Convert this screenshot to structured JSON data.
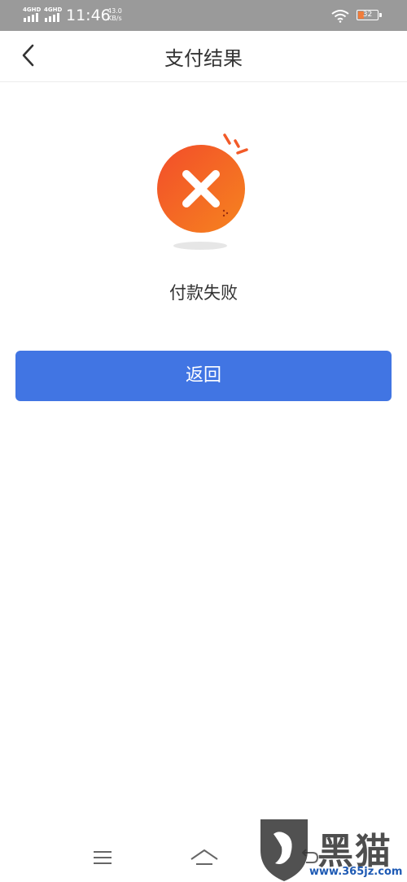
{
  "status_bar": {
    "network_1": "4GHD",
    "network_2": "4GHD",
    "time": "11:46",
    "speed_value": "43.0",
    "speed_unit": "KB/s",
    "battery": "32"
  },
  "header": {
    "title": "支付结果"
  },
  "result": {
    "message": "付款失败",
    "accent_color": "#f25a28"
  },
  "actions": {
    "back_label": "返回",
    "button_color": "#4175e3"
  },
  "watermark": {
    "text": "黑猫",
    "url": "www.365jz.com"
  },
  "icons": [
    "back-arrow-icon",
    "error-x-icon",
    "wifi-icon",
    "battery-icon",
    "menu-icon",
    "home-icon",
    "return-icon"
  ]
}
